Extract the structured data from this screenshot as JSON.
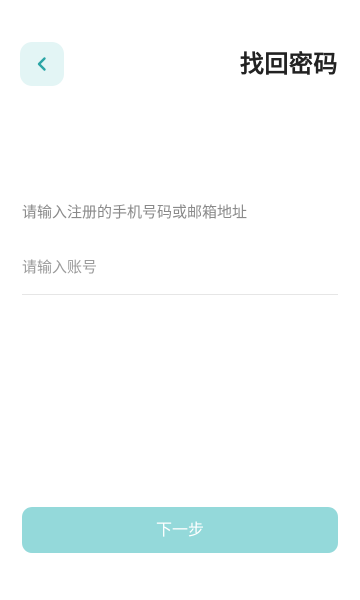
{
  "header": {
    "back_icon": "chevron-left-icon",
    "title": "找回密码"
  },
  "form": {
    "hint": "请输入注册的手机号码或邮箱地址",
    "account_placeholder": "请输入账号",
    "account_value": ""
  },
  "actions": {
    "next_label": "下一步"
  },
  "colors": {
    "accent": "#2ba5a6",
    "back_button_bg": "#e3f5f5",
    "next_button_bg": "#94d9da"
  }
}
